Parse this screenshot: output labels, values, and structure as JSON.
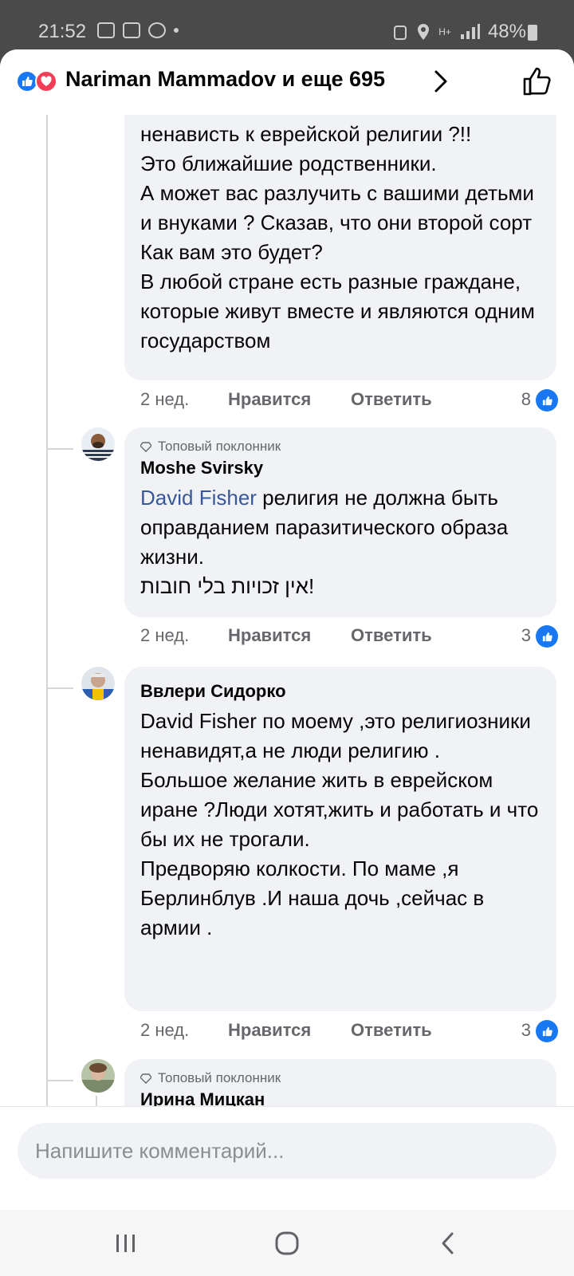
{
  "status_bar": {
    "time": "21:52",
    "battery": "48%",
    "network": "H+"
  },
  "header": {
    "title": "Nariman Mammadov и еще 695",
    "reaction_icons": [
      "like-icon",
      "love-icon"
    ]
  },
  "comments": [
    {
      "text": "ненависть к еврейской религии ?!!\nЭто ближайшие родственники.\nА может вас разлучить с вашими детьми и внуками ? Сказав, что они второй сорт\nКак вам это будет?\nВ любой стране есть разные граждане, которые живут вместе и являются одним государством",
      "time": "2 нед.",
      "like_label": "Нравится",
      "reply_label": "Ответить",
      "reactions": "8"
    },
    {
      "badge": "Топовый поклонник",
      "author": "Moshe Svirsky",
      "mention": "David Fisher",
      "text": " религия не должна быть оправданием паразитического образа жизни.\nאין זכויות בלי חובות!",
      "time": "2 нед.",
      "like_label": "Нравится",
      "reply_label": "Ответить",
      "reactions": "3"
    },
    {
      "author": "Ввлери Сидорко",
      "text": "David Fisher по моему ,это религиозники ненавидят,а не люди религию .\nБольшое желание жить в еврейском иране ?Люди хотят,жить и работать и что бы их не трогали.\nПредворяю колкости. По маме ,я Берлинблув .И наша дочь ,сейчас в армии .",
      "time": "2 нед.",
      "like_label": "Нравится",
      "reply_label": "Ответить",
      "reactions": "3"
    },
    {
      "badge": "Топовый поклонник",
      "author": "Ирина Мицкан"
    }
  ],
  "composer": {
    "placeholder": "Напишите комментарий..."
  },
  "colors": {
    "accent": "#1877f2",
    "love": "#f33e58",
    "bubble": "#f0f2f5",
    "secondary_text": "#65676b"
  }
}
